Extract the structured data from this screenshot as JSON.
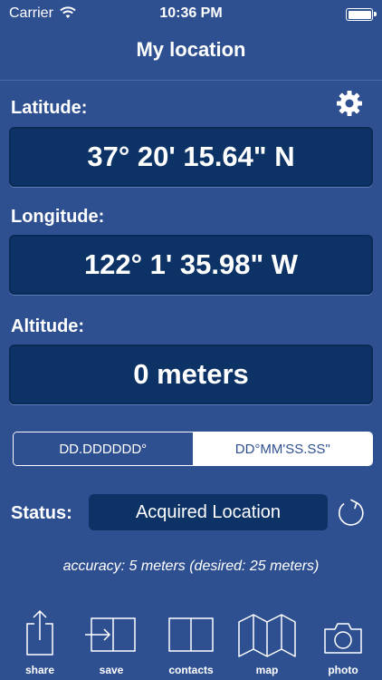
{
  "status_bar": {
    "carrier": "Carrier",
    "time": "10:36 PM"
  },
  "nav": {
    "title": "My location"
  },
  "latitude": {
    "label": "Latitude:",
    "value": "37° 20' 15.64\" N"
  },
  "longitude": {
    "label": "Longitude:",
    "value": "122° 1' 35.98\" W"
  },
  "altitude": {
    "label": "Altitude:",
    "value": "0 meters"
  },
  "format_toggle": {
    "options": [
      "DD.DDDDDD°",
      "DD°MM'SS.SS\""
    ],
    "selected": "DD°MM'SS.SS\""
  },
  "status": {
    "label": "Status:",
    "value": "Acquired Location"
  },
  "accuracy": "accuracy: 5 meters (desired: 25 meters)",
  "toolbar": {
    "share": "share",
    "save": "save",
    "contacts": "contacts",
    "map": "map",
    "photo": "photo"
  },
  "colors": {
    "background": "#2f5090",
    "value_box": "#0c3266",
    "text": "#ffffff"
  }
}
